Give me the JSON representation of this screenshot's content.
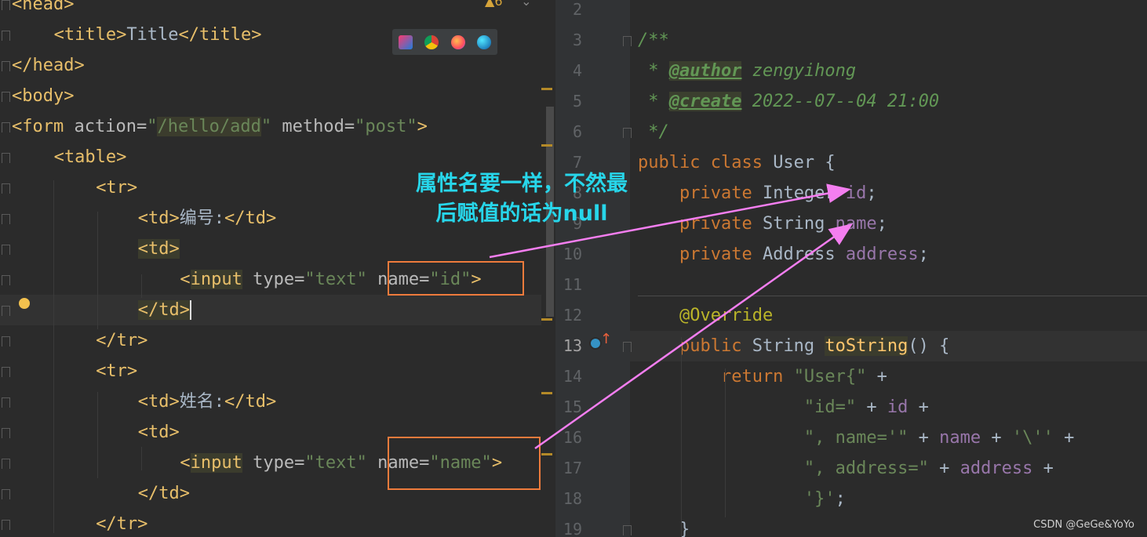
{
  "left_editor": {
    "warning_count": "6",
    "lines": [
      {
        "parts": [
          [
            "tag",
            "<head>"
          ]
        ]
      },
      {
        "parts": [
          [
            "tag",
            "<title>"
          ],
          [
            "txt",
            "Title"
          ],
          [
            "tag",
            "</title>"
          ]
        ]
      },
      {
        "parts": [
          [
            "tag",
            "</head>"
          ]
        ]
      },
      {
        "parts": [
          [
            "tag",
            "<body>"
          ]
        ]
      },
      {
        "parts": [
          [
            "tag",
            "<form "
          ],
          [
            "attr",
            "action="
          ],
          [
            "str",
            "\""
          ],
          [
            "str",
            "/hello/add"
          ],
          [
            "str",
            "\""
          ],
          [
            "attr",
            " method="
          ],
          [
            "str",
            "\"post\""
          ],
          [
            "tag",
            ">"
          ]
        ]
      },
      {
        "parts": [
          [
            "tag",
            "<table>"
          ]
        ]
      },
      {
        "parts": [
          [
            "tag",
            "<tr>"
          ]
        ]
      },
      {
        "parts": [
          [
            "tag",
            "<td>"
          ],
          [
            "txt",
            "编号:"
          ],
          [
            "tag",
            "</td>"
          ]
        ]
      },
      {
        "parts": [
          [
            "tag",
            "<td>"
          ]
        ]
      },
      {
        "parts": [
          [
            "tag",
            "<"
          ],
          [
            "tag",
            "input"
          ],
          [
            "attr",
            " type="
          ],
          [
            "str",
            "\"text\""
          ],
          [
            "attr",
            " name="
          ],
          [
            "str",
            "\"id\""
          ],
          [
            "tag",
            ">"
          ]
        ]
      },
      {
        "parts": [
          [
            "tag",
            "</td>"
          ]
        ]
      },
      {
        "parts": [
          [
            "tag",
            "</tr>"
          ]
        ]
      },
      {
        "parts": [
          [
            "tag",
            "<tr>"
          ]
        ]
      },
      {
        "parts": [
          [
            "tag",
            "<td>"
          ],
          [
            "txt",
            "姓名:"
          ],
          [
            "tag",
            "</td>"
          ]
        ]
      },
      {
        "parts": [
          [
            "tag",
            "<td>"
          ]
        ]
      },
      {
        "parts": [
          [
            "tag",
            "<"
          ],
          [
            "tag",
            "input"
          ],
          [
            "attr",
            " type="
          ],
          [
            "str",
            "\"text\""
          ],
          [
            "attr",
            " name="
          ],
          [
            "str",
            "\"name\""
          ],
          [
            "tag",
            ">"
          ]
        ]
      },
      {
        "parts": [
          [
            "tag",
            "</td>"
          ]
        ]
      },
      {
        "parts": [
          [
            "tag",
            "</tr>"
          ]
        ]
      }
    ]
  },
  "right_editor": {
    "line_numbers": [
      "2",
      "3",
      "4",
      "5",
      "6",
      "7",
      "8",
      "9",
      "10",
      "11",
      "12",
      "13",
      "14",
      "15",
      "16",
      "17",
      "18",
      "19"
    ],
    "lines": [
      {
        "parts": []
      },
      {
        "parts": [
          [
            "doc",
            "/**"
          ]
        ]
      },
      {
        "parts": [
          [
            "doc",
            " * "
          ],
          [
            "doctag",
            "@author"
          ],
          [
            "doc",
            " zengyihong"
          ]
        ]
      },
      {
        "parts": [
          [
            "doc",
            " * "
          ],
          [
            "doctag",
            "@create"
          ],
          [
            "doc",
            " 2022--07--04 21:00"
          ]
        ]
      },
      {
        "parts": [
          [
            "doc",
            " */"
          ]
        ]
      },
      {
        "parts": [
          [
            "kw",
            "public class "
          ],
          [
            "txt",
            "User {"
          ]
        ]
      },
      {
        "parts": [
          [
            "kw",
            "    private "
          ],
          [
            "txt",
            "Integer "
          ],
          [
            "field",
            "id"
          ],
          [
            "txt",
            ";"
          ]
        ]
      },
      {
        "parts": [
          [
            "kw",
            "    private "
          ],
          [
            "txt",
            "String "
          ],
          [
            "field",
            "name"
          ],
          [
            "txt",
            ";"
          ]
        ]
      },
      {
        "parts": [
          [
            "kw",
            "    private "
          ],
          [
            "txt",
            "Address "
          ],
          [
            "field",
            "address"
          ],
          [
            "txt",
            ";"
          ]
        ]
      },
      {
        "parts": []
      },
      {
        "parts": [
          [
            "ann",
            "    @Override"
          ]
        ]
      },
      {
        "parts": [
          [
            "kw",
            "    public "
          ],
          [
            "txt",
            "String "
          ],
          [
            "fn",
            "toString"
          ],
          [
            "txt",
            "() {"
          ]
        ]
      },
      {
        "parts": [
          [
            "kw",
            "        return "
          ],
          [
            "str",
            "\"User{\""
          ],
          [
            "txt",
            " +"
          ]
        ]
      },
      {
        "parts": [
          [
            "str",
            "                \"id=\""
          ],
          [
            "txt",
            " + "
          ],
          [
            "field",
            "id"
          ],
          [
            "txt",
            " +"
          ]
        ]
      },
      {
        "parts": [
          [
            "str",
            "                \", name='\""
          ],
          [
            "txt",
            " + "
          ],
          [
            "field",
            "name"
          ],
          [
            "txt",
            " + "
          ],
          [
            "str",
            "'\\''"
          ],
          [
            "txt",
            " +"
          ]
        ]
      },
      {
        "parts": [
          [
            "str",
            "                \", address=\""
          ],
          [
            "txt",
            " + "
          ],
          [
            "field",
            "address"
          ],
          [
            "txt",
            " +"
          ]
        ]
      },
      {
        "parts": [
          [
            "str",
            "                '}'"
          ],
          [
            "txt",
            ";"
          ]
        ]
      },
      {
        "parts": [
          [
            "txt",
            "    }"
          ]
        ]
      }
    ]
  },
  "annotation": {
    "line1": "属性名要一样，不然最",
    "line2": "后赋值的话为null"
  },
  "browser_icons": [
    "intellij-icon",
    "chrome-icon",
    "firefox-icon",
    "edge-icon"
  ],
  "watermark": "CSDN @GeGe&YoYo",
  "colors": {
    "tag": "#e8bf6a",
    "string": "#6a8759",
    "keyword": "#cc7832",
    "field": "#9876aa",
    "annotation_text": "#27d6ea",
    "box": "#ee7b3c",
    "arrow": "#f47ef0"
  }
}
